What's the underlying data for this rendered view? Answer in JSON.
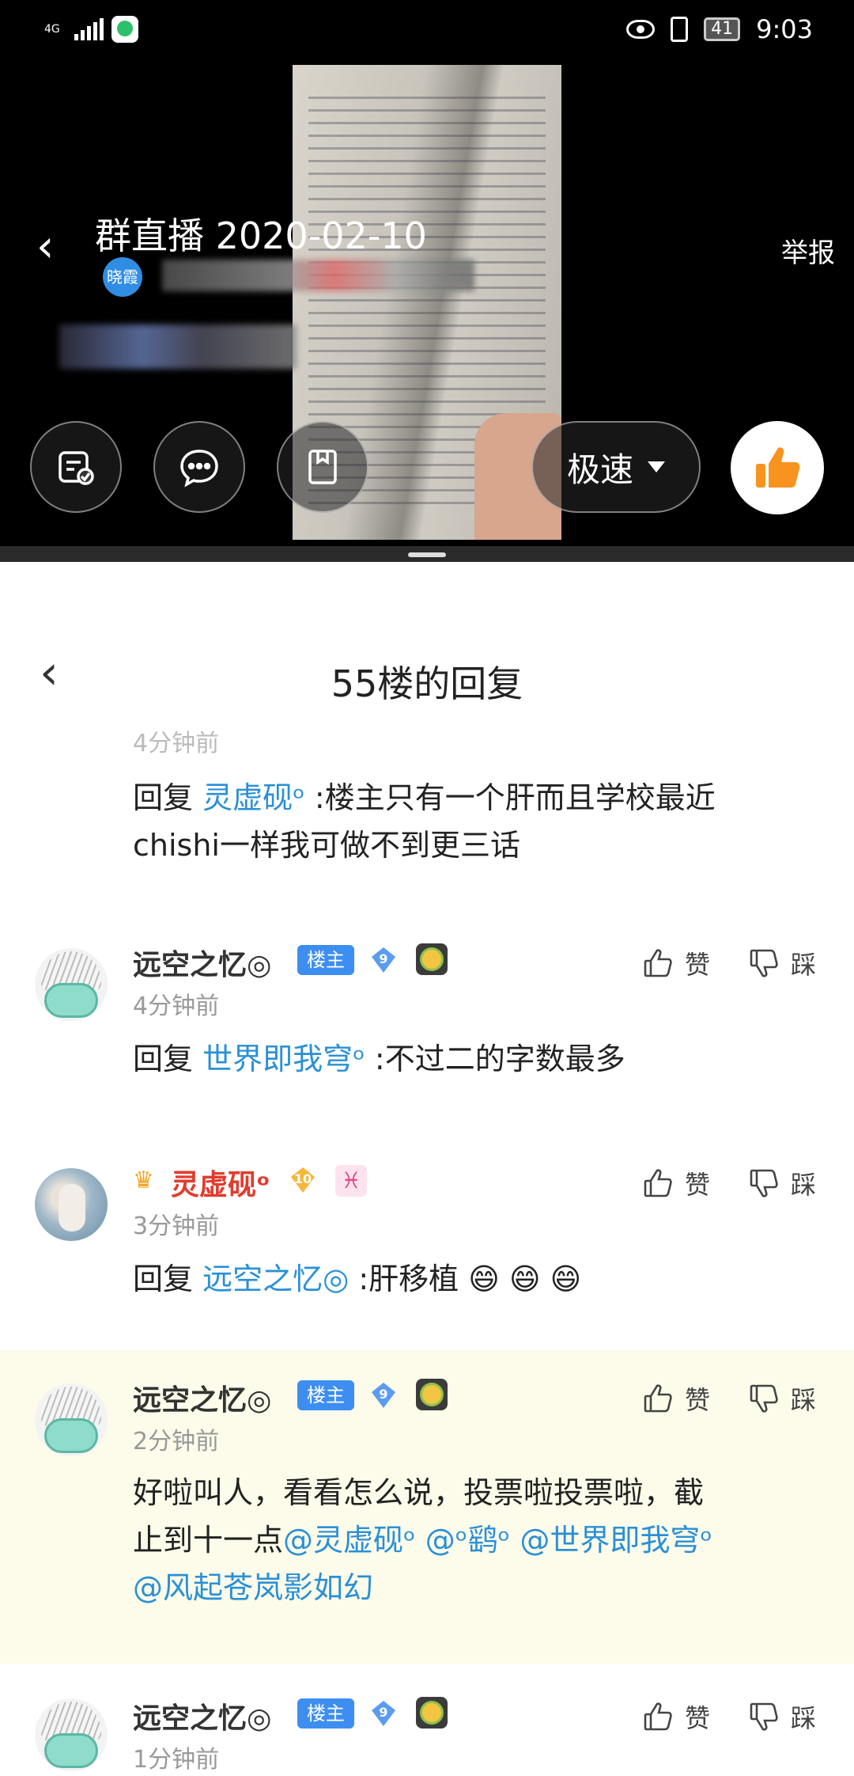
{
  "status_bar": {
    "network": "4G",
    "battery": "41",
    "time": "9:03"
  },
  "live": {
    "title": "群直播 2020-02-10",
    "host_tag": "晓霞",
    "report_label": "举报",
    "speed_label": "极速",
    "controls": [
      "task-icon",
      "chat-icon",
      "bookmark-icon",
      "thumbs-up-icon"
    ]
  },
  "panel": {
    "title": "55楼的回复"
  },
  "colors": {
    "accent": "#2a90d6",
    "badge": "#3d8ef0",
    "vip_name": "#e03c2e",
    "highlight_bg": "#fdfbea"
  },
  "actions": {
    "like": "赞",
    "dislike": "踩"
  },
  "posts": [
    {
      "time": "4分钟前",
      "reply_prefix": "回复",
      "mention": "灵虚砚ᵒ",
      "text_line1": ":楼主只有一个肝而且学校最近",
      "text_line2": "chishi一样我可做不到更三话"
    },
    {
      "name": "远空之忆◎",
      "badge": "楼主",
      "level": "9",
      "time": "4分钟前",
      "reply_prefix": "回复",
      "mention": "世界即我穹ᵒ",
      "text": ":不过二的字数最多"
    },
    {
      "name": "灵虚砚ᵒ",
      "level": "10",
      "zodiac": "♓",
      "time": "3分钟前",
      "reply_prefix": "回复",
      "mention": "远空之忆◎",
      "text": ":肝移植",
      "emojis": "😄 😄 😄"
    },
    {
      "name": "远空之忆◎",
      "badge": "楼主",
      "level": "9",
      "time": "2分钟前",
      "text_line1": "好啦叫人，看看怎么说，投票啦投票啦，截",
      "text_line2_prefix": "止到十一点",
      "mentions_line2": "@灵虚砚ᵒ  @ᵒ鹞ᵒ  @世界即我穹ᵒ",
      "mentions_line3": "@风起苍岚影如幻"
    },
    {
      "name": "远空之忆◎",
      "badge": "楼主",
      "level": "9",
      "time": "1分钟前"
    }
  ]
}
